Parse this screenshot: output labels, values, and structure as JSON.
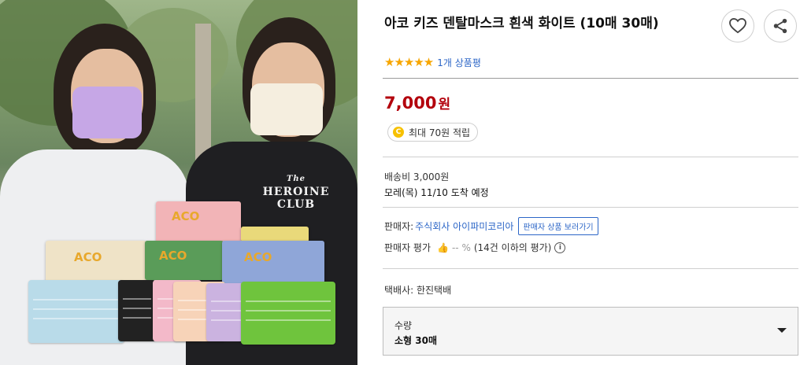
{
  "product": {
    "title": "아코 키즈 덴탈마스크 흰색 화이트 (10매 30매)",
    "rating_stars": "★★★★★",
    "review_link": "1개 상품평",
    "price_value": "7,000",
    "price_unit": "원",
    "points_icon": "C",
    "points_text": "최대 70원 적립"
  },
  "shipping": {
    "fee": "배송비 3,000원",
    "arrival": "모레(목) 11/10 도착 예정"
  },
  "seller": {
    "label": "판매자:",
    "name": "주식회사 아이파미코리아",
    "store_button": "판매자 상품 보러가기",
    "rating_label": "판매자 평가",
    "rating_value": "-- %",
    "rating_note": "(14건 이하의 평가)",
    "info_icon": "i"
  },
  "courier": {
    "text": "택배사: 한진택배"
  },
  "option": {
    "label": "수량",
    "selected": "소형 30매"
  },
  "image_text": {
    "shirt_line1": "The",
    "shirt_line2": "HEROINE",
    "shirt_line3": "CLUB",
    "box_logo": "ACO"
  },
  "icons": {
    "wishlist": "heart-icon",
    "share": "share-icon",
    "thumb": "thumbs-up-icon",
    "caret": "chevron-down-icon"
  },
  "colors": {
    "price": "#b3000c",
    "link": "#2c66c7",
    "star": "#f7a600",
    "coin": "#f7c100"
  }
}
